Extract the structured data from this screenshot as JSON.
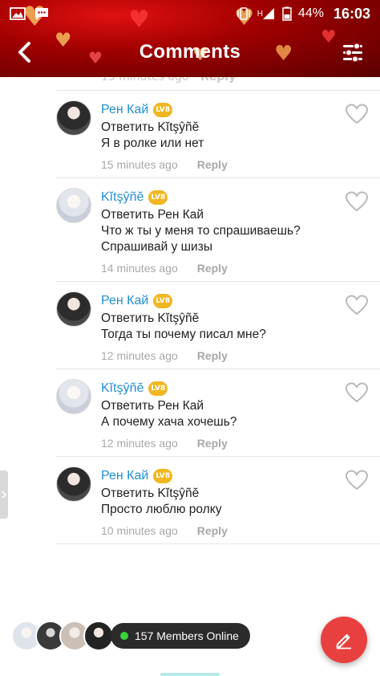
{
  "status_bar": {
    "time": "16:03",
    "battery": "44%",
    "network": "H",
    "icons": [
      "gallery-icon",
      "chat-notification-icon",
      "vibrate-icon",
      "signal-icon",
      "battery-icon"
    ]
  },
  "header": {
    "title": "Comments",
    "back_icon": "back-arrow-icon",
    "filter_icon": "filter-sliders-icon",
    "accent": "#b00000"
  },
  "comments": [
    {
      "author": "Рен Кай",
      "level": "LV8",
      "reply_to": "Ответить Kĭtşŷñĕ",
      "lines": [
        "Я в ролке или нет"
      ],
      "time": "15 minutes ago",
      "reply_label": "Reply"
    },
    {
      "author": "Kĭtşŷñĕ",
      "level": "LV8",
      "reply_to": "Ответить Рен Кай",
      "lines": [
        "Что ж ты у меня то спрашиваешь?",
        "Спрашивай у шизы"
      ],
      "time": "14 minutes ago",
      "reply_label": "Reply"
    },
    {
      "author": "Рен Кай",
      "level": "LV8",
      "reply_to": "Ответить Kĭtşŷñĕ",
      "lines": [
        "Тогда ты почему писал мне?"
      ],
      "time": "12 minutes ago",
      "reply_label": "Reply"
    },
    {
      "author": "Kĭtşŷñĕ",
      "level": "LV8",
      "reply_to": "Ответить Рен Кай",
      "lines": [
        "А почему хача хочешь?"
      ],
      "time": "12 minutes ago",
      "reply_label": "Reply"
    },
    {
      "author": "Рен Кай",
      "level": "LV8",
      "reply_to": "Ответить Kĭtşŷñĕ",
      "lines": [
        "Просто люблю ролку"
      ],
      "time": "10 minutes ago",
      "reply_label": "Reply"
    }
  ],
  "top_partial": {
    "time": "15 minutes ago",
    "reply_label": "Reply"
  },
  "online": {
    "label": "157 Members Online",
    "status_color": "#3ad33a"
  },
  "fab": {
    "icon": "pencil-icon",
    "color": "#e8403f"
  },
  "colors": {
    "author_link": "#1e8fd6",
    "meta_gray": "#a8a8a8",
    "badge": "#f0b722"
  }
}
